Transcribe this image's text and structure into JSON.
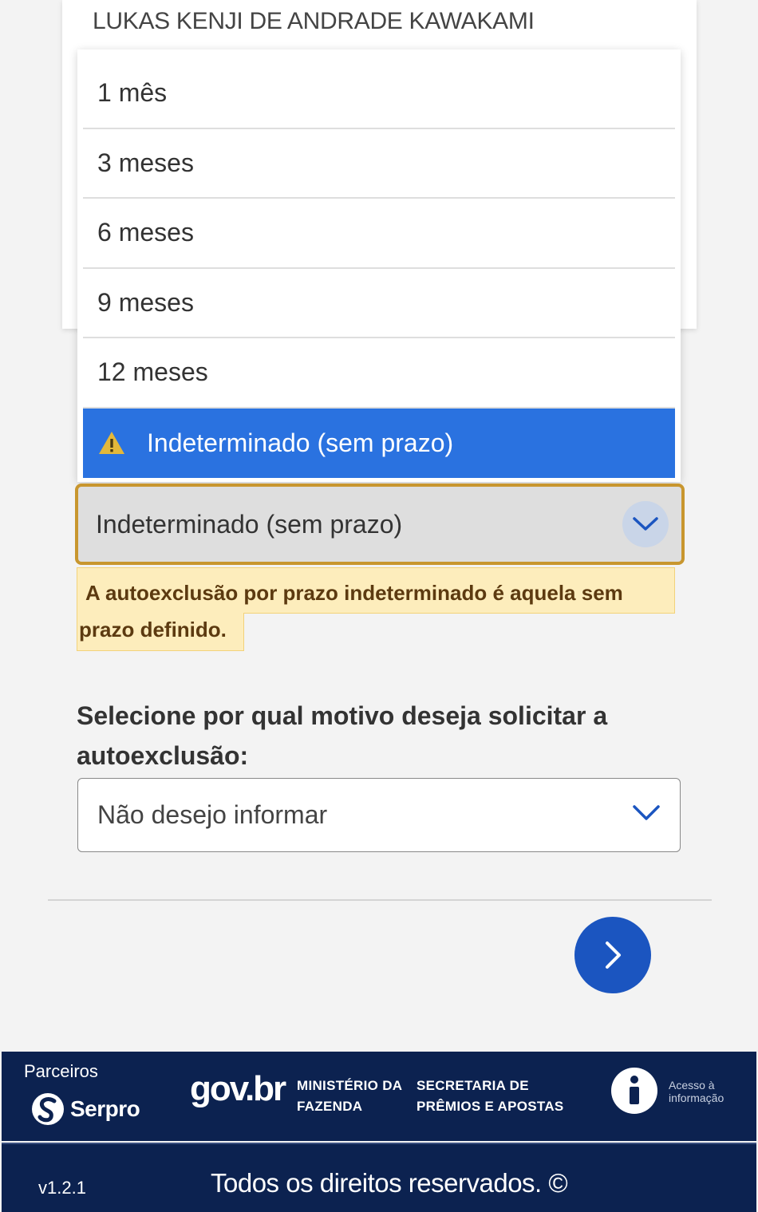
{
  "user": {
    "name": "LUKAS KENJI DE ANDRADE KAWAKAMI"
  },
  "period_dropdown": {
    "options": [
      {
        "label": "1 mês"
      },
      {
        "label": "3 meses"
      },
      {
        "label": "6 meses"
      },
      {
        "label": "9 meses"
      },
      {
        "label": "12 meses"
      },
      {
        "label": "Indeterminado (sem prazo)",
        "icon": "warning-icon",
        "selected": true
      }
    ],
    "selected_value": "Indeterminado (sem prazo)"
  },
  "hint": {
    "line1": "A autoexclusão por prazo indeterminado é aquela sem",
    "line2": "prazo definido."
  },
  "reason": {
    "question": "Selecione por qual motivo deseja solicitar a autoexclusão:",
    "selected_value": "Não desejo informar"
  },
  "footer": {
    "partners_label": "Parceiros",
    "serpro": "Serpro",
    "govbr": "gov.br",
    "ministerio_line1": "MINISTÉRIO DA",
    "ministerio_line2": "FAZENDA",
    "secretaria_line1": "SECRETARIA DE",
    "secretaria_line2": "PRÊMIOS E APOSTAS",
    "info_line1": "Acesso à",
    "info_line2": "informação",
    "version": "v1.2.1",
    "rights": "Todos os direitos reservados. ©"
  },
  "colors": {
    "selected_option": "#2a72e0",
    "focus_border": "#c8962e",
    "hint_bg": "#fdedbc",
    "next_button": "#1b55c0",
    "footer_bg": "#0c2250"
  }
}
